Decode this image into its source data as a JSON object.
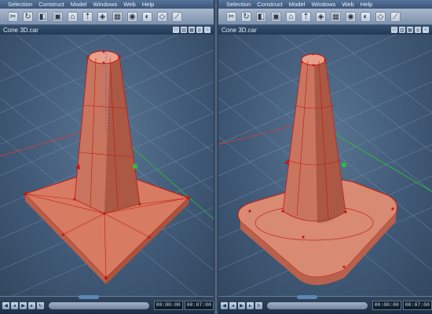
{
  "menu": [
    "Selection",
    "Construct",
    "Model",
    "Windows",
    "Web",
    "Help"
  ],
  "toolbar_icons": [
    "scissors-icon",
    "loop-icon",
    "face-icon",
    "select-icon",
    "extrude-icon",
    "push-icon",
    "weld-icon",
    "grid-icon",
    "view-icon",
    "shade-icon",
    "wire-icon",
    "knife-icon",
    "light-icon",
    "camera-icon"
  ],
  "panes": [
    {
      "doc_title": "Cone 3D.car",
      "mesh": "sharp",
      "time_current": "00:00:00",
      "time_end": "00:07:00"
    },
    {
      "doc_title": "Cone 3D.car",
      "mesh": "smooth",
      "time_current": "00:00:00",
      "time_end": "00:07:00"
    }
  ],
  "colors": {
    "accent": "#e0846a",
    "grid": "#7f9ab5",
    "wire": "#c31a12"
  }
}
